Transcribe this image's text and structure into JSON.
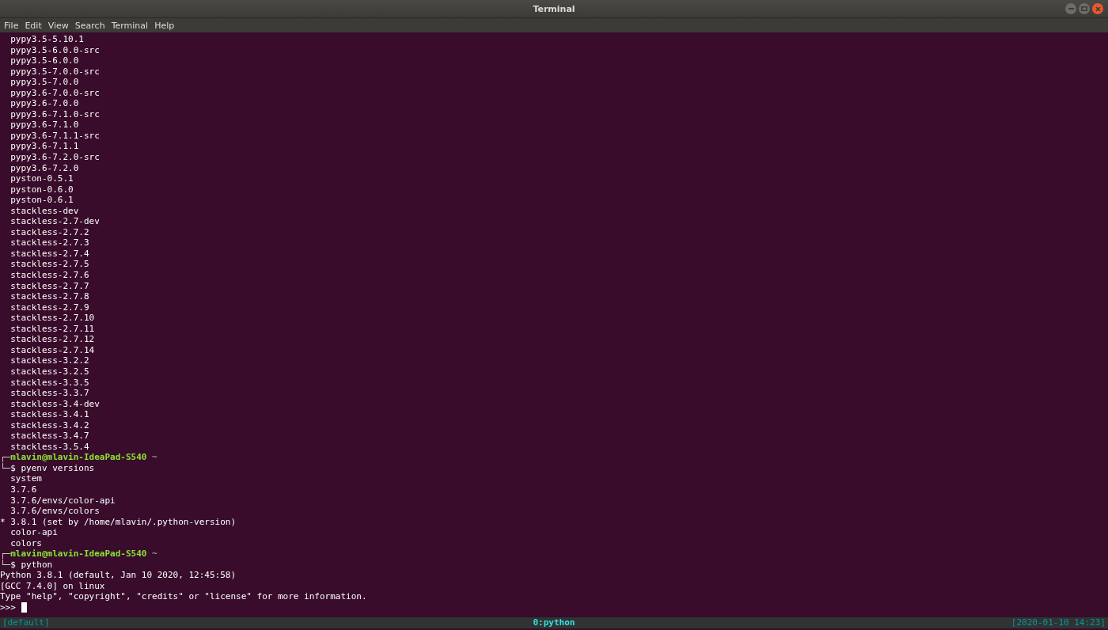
{
  "window": {
    "title": "Terminal"
  },
  "menu": [
    "File",
    "Edit",
    "View",
    "Search",
    "Terminal",
    "Help"
  ],
  "lines": [
    {
      "kind": "output",
      "text": "  pypy3.5-5.10.1"
    },
    {
      "kind": "output",
      "text": "  pypy3.5-6.0.0-src"
    },
    {
      "kind": "output",
      "text": "  pypy3.5-6.0.0"
    },
    {
      "kind": "output",
      "text": "  pypy3.5-7.0.0-src"
    },
    {
      "kind": "output",
      "text": "  pypy3.5-7.0.0"
    },
    {
      "kind": "output",
      "text": "  pypy3.6-7.0.0-src"
    },
    {
      "kind": "output",
      "text": "  pypy3.6-7.0.0"
    },
    {
      "kind": "output",
      "text": "  pypy3.6-7.1.0-src"
    },
    {
      "kind": "output",
      "text": "  pypy3.6-7.1.0"
    },
    {
      "kind": "output",
      "text": "  pypy3.6-7.1.1-src"
    },
    {
      "kind": "output",
      "text": "  pypy3.6-7.1.1"
    },
    {
      "kind": "output",
      "text": "  pypy3.6-7.2.0-src"
    },
    {
      "kind": "output",
      "text": "  pypy3.6-7.2.0"
    },
    {
      "kind": "output",
      "text": "  pyston-0.5.1"
    },
    {
      "kind": "output",
      "text": "  pyston-0.6.0"
    },
    {
      "kind": "output",
      "text": "  pyston-0.6.1"
    },
    {
      "kind": "output",
      "text": "  stackless-dev"
    },
    {
      "kind": "output",
      "text": "  stackless-2.7-dev"
    },
    {
      "kind": "output",
      "text": "  stackless-2.7.2"
    },
    {
      "kind": "output",
      "text": "  stackless-2.7.3"
    },
    {
      "kind": "output",
      "text": "  stackless-2.7.4"
    },
    {
      "kind": "output",
      "text": "  stackless-2.7.5"
    },
    {
      "kind": "output",
      "text": "  stackless-2.7.6"
    },
    {
      "kind": "output",
      "text": "  stackless-2.7.7"
    },
    {
      "kind": "output",
      "text": "  stackless-2.7.8"
    },
    {
      "kind": "output",
      "text": "  stackless-2.7.9"
    },
    {
      "kind": "output",
      "text": "  stackless-2.7.10"
    },
    {
      "kind": "output",
      "text": "  stackless-2.7.11"
    },
    {
      "kind": "output",
      "text": "  stackless-2.7.12"
    },
    {
      "kind": "output",
      "text": "  stackless-2.7.14"
    },
    {
      "kind": "output",
      "text": "  stackless-3.2.2"
    },
    {
      "kind": "output",
      "text": "  stackless-3.2.5"
    },
    {
      "kind": "output",
      "text": "  stackless-3.3.5"
    },
    {
      "kind": "output",
      "text": "  stackless-3.3.7"
    },
    {
      "kind": "output",
      "text": "  stackless-3.4-dev"
    },
    {
      "kind": "output",
      "text": "  stackless-3.4.1"
    },
    {
      "kind": "output",
      "text": "  stackless-3.4.2"
    },
    {
      "kind": "output",
      "text": "  stackless-3.4.7"
    },
    {
      "kind": "output",
      "text": "  stackless-3.5.4"
    },
    {
      "kind": "prompt",
      "corner": "┌─",
      "user_host": "mlavin@mlavin-IdeaPad-S540",
      "path": "~"
    },
    {
      "kind": "command",
      "corner": "└─",
      "symbol": "$",
      "text": "pyenv versions"
    },
    {
      "kind": "output",
      "text": "  system"
    },
    {
      "kind": "output",
      "text": "  3.7.6"
    },
    {
      "kind": "output",
      "text": "  3.7.6/envs/color-api"
    },
    {
      "kind": "output",
      "text": "  3.7.6/envs/colors"
    },
    {
      "kind": "output",
      "text": "* 3.8.1 (set by /home/mlavin/.python-version)"
    },
    {
      "kind": "output",
      "text": "  color-api"
    },
    {
      "kind": "output",
      "text": "  colors"
    },
    {
      "kind": "prompt",
      "corner": "┌─",
      "user_host": "mlavin@mlavin-IdeaPad-S540",
      "path": "~"
    },
    {
      "kind": "command",
      "corner": "└─",
      "symbol": "$",
      "text": "python"
    },
    {
      "kind": "output",
      "text": "Python 3.8.1 (default, Jan 10 2020, 12:45:58)"
    },
    {
      "kind": "output",
      "text": "[GCC 7.4.0] on linux"
    },
    {
      "kind": "output",
      "text": "Type \"help\", \"copyright\", \"credits\" or \"license\" for more information."
    },
    {
      "kind": "input",
      "text": ">>> "
    }
  ],
  "status_bar": {
    "session": "[default]",
    "window": "0:python",
    "clock": "[2020-01-10 14:23]"
  }
}
